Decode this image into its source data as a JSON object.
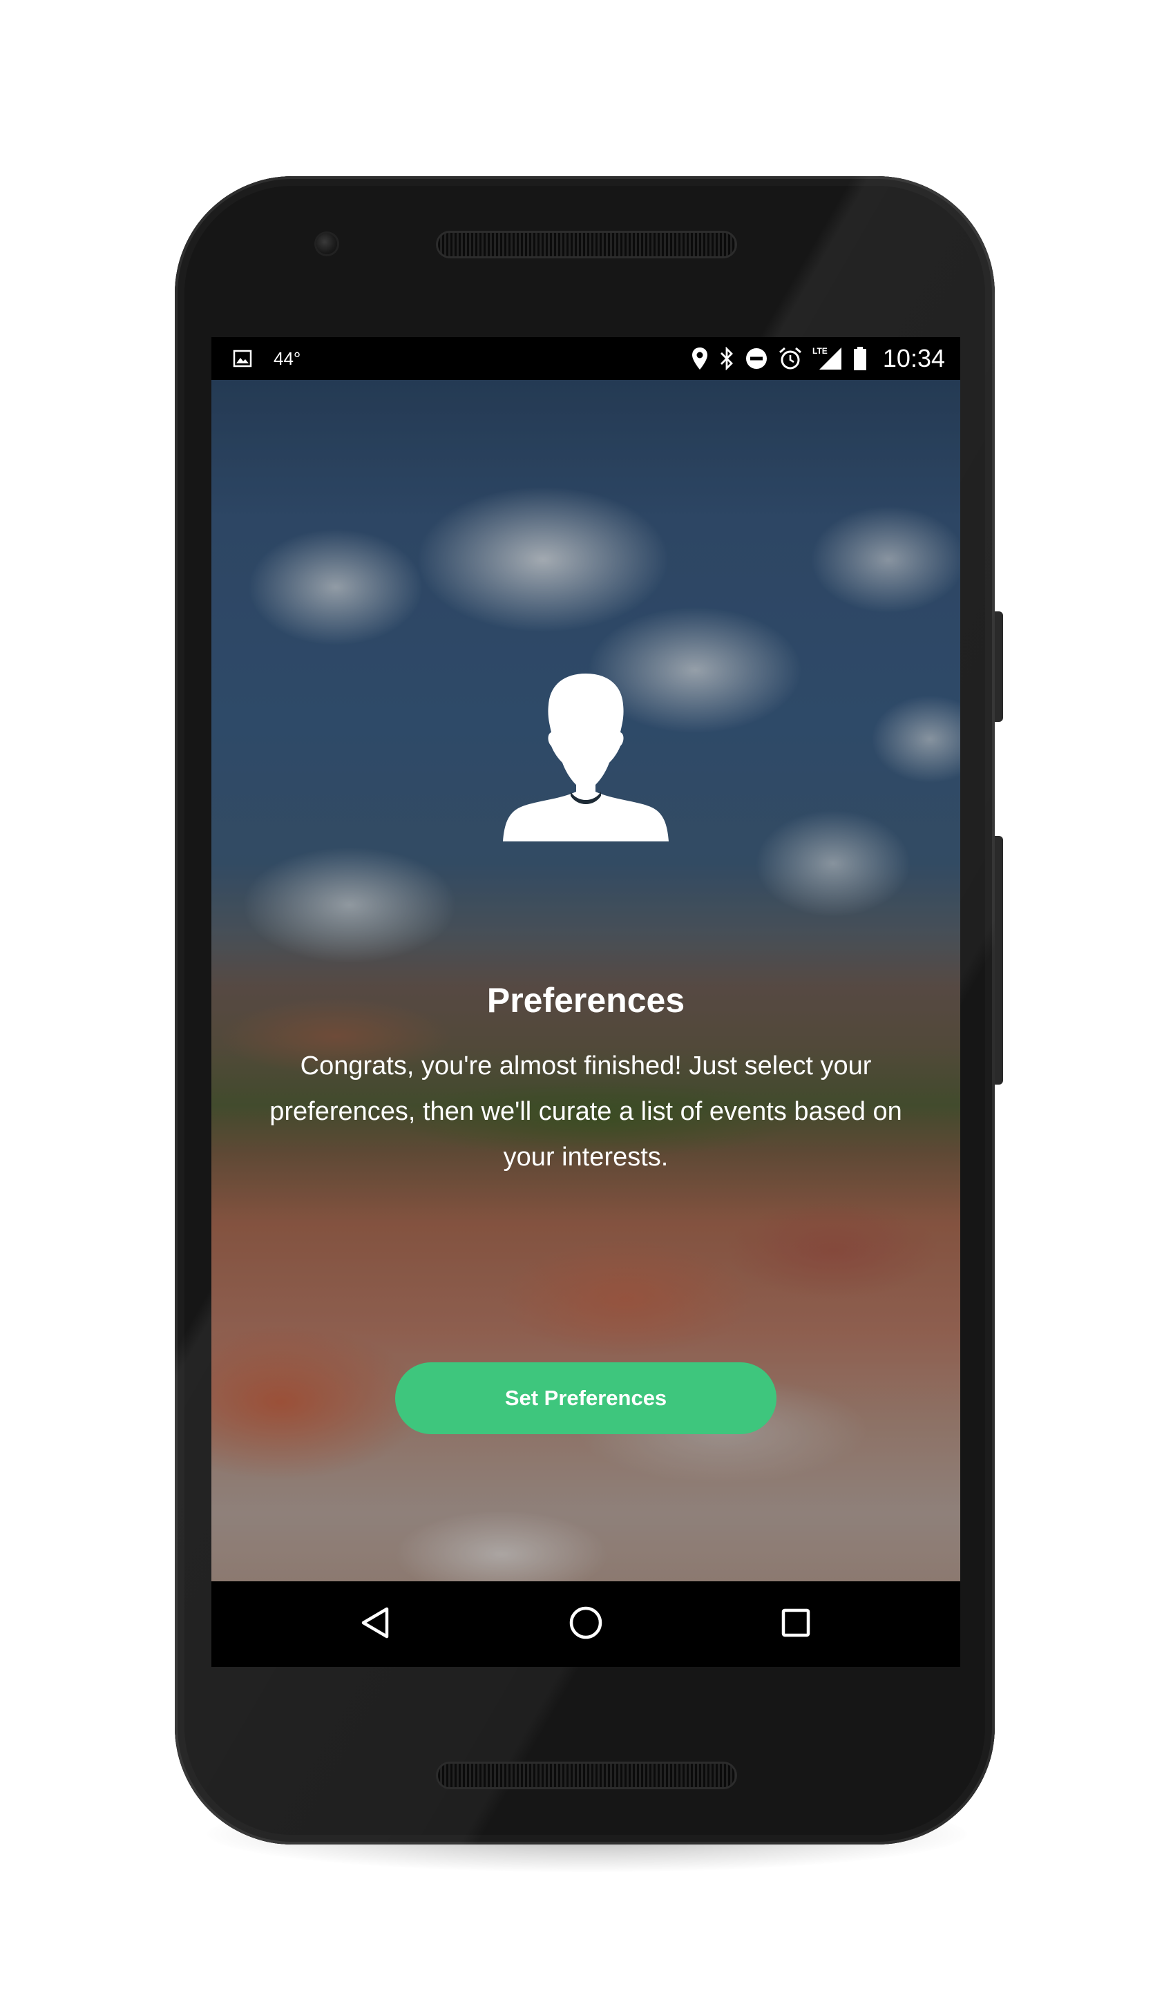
{
  "status_bar": {
    "temperature": "44°",
    "network_label": "LTE",
    "time": "10:34",
    "left_icons": [
      "image-notification-icon"
    ],
    "right_icons": [
      "location-icon",
      "bluetooth-icon",
      "do-not-disturb-icon",
      "alarm-icon",
      "signal-icon",
      "battery-icon"
    ]
  },
  "main": {
    "avatar_icon": "user-profile-icon",
    "title": "Preferences",
    "description": "Congrats, you're almost finished! Just select your preferences, then we'll curate a list of events based on your interests.",
    "primary_button": "Set Preferences"
  },
  "nav_bar": {
    "icons": [
      "back-icon",
      "home-icon",
      "recents-icon"
    ]
  },
  "colors": {
    "accent": "#3ec67d",
    "status_bar": "#000000",
    "nav_bar": "#000000",
    "phone_body": "#161616",
    "text": "#ffffff"
  }
}
